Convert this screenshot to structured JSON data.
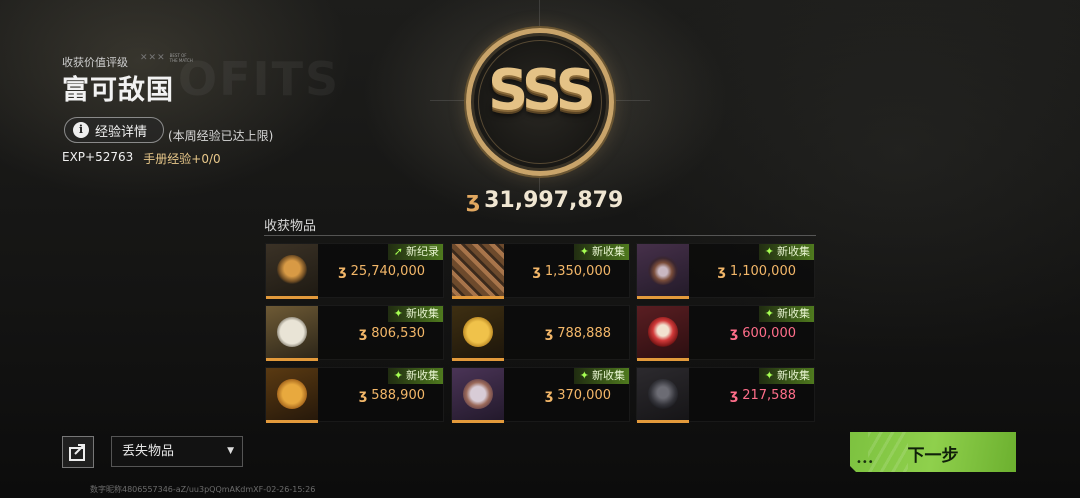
{
  "header": {
    "rating_label": "收获价值评级",
    "rating_title": "富可敌国",
    "badge_note_lines": [
      "BEST OF",
      "THE MATCH"
    ],
    "exp_button_label": "经验详情",
    "exp_limit_note": "(本周经验已达上限)",
    "exp_gain": "EXP+52763",
    "handbook_exp": "手册经验+0/0"
  },
  "badge": {
    "grade": "SSS",
    "total_value": "31,997,879"
  },
  "items_section": {
    "title": "收获物品",
    "items": [
      {
        "tag": "新纪录",
        "tag_icon": "arrow-up-right-icon",
        "value": "25,740,000",
        "value_color": "#f3b769",
        "art": "horse-statue"
      },
      {
        "tag": "新收集",
        "tag_icon": "sparkle-icon",
        "value": "1,350,000",
        "value_color": "#f3b769",
        "art": "ornate-box"
      },
      {
        "tag": "新收集",
        "tag_icon": "sparkle-icon",
        "value": "1,100,000",
        "value_color": "#f3b769",
        "art": "vase"
      },
      {
        "tag": "新收集",
        "tag_icon": "sparkle-icon",
        "value": "806,530",
        "value_color": "#f3b769",
        "art": "silver-medal"
      },
      {
        "tag": "",
        "tag_icon": "",
        "value": "788,888",
        "value_color": "#f3b769",
        "art": "gold-coin"
      },
      {
        "tag": "新收集",
        "tag_icon": "sparkle-icon",
        "value": "600,000",
        "value_color": "#ff6e8a",
        "art": "opera-mask"
      },
      {
        "tag": "新收集",
        "tag_icon": "sparkle-icon",
        "value": "588,900",
        "value_color": "#f3b769",
        "art": "dragon-coin"
      },
      {
        "tag": "新收集",
        "tag_icon": "sparkle-icon",
        "value": "370,000",
        "value_color": "#f3b769",
        "art": "pocket-watch"
      },
      {
        "tag": "新收集",
        "tag_icon": "sparkle-icon",
        "value": "217,588",
        "value_color": "#ff6e8a",
        "art": "helmet"
      }
    ]
  },
  "footer": {
    "dropdown_value": "丢失物品",
    "next_button_label": "下一步",
    "watermark": "数字昵称4806557346-aZ/uu3pQQmAKdmXF-02-26-15:26"
  },
  "colors": {
    "accent_gold": "#c9a46a",
    "value_orange": "#f3b769",
    "value_pink": "#ff6e8a",
    "tag_green": "#4f7a1e",
    "next_green": "#8fd04c",
    "rarity_bar": "#e39a3b"
  }
}
